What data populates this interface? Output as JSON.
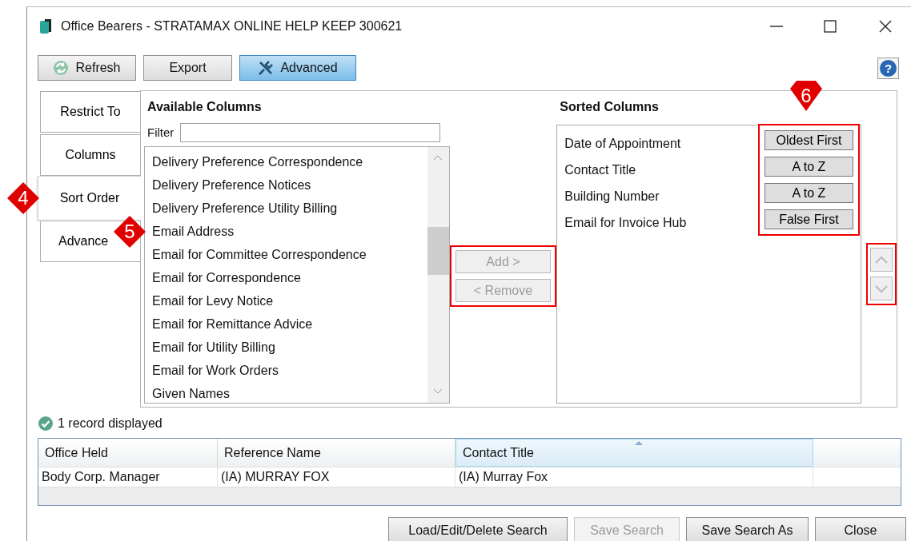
{
  "window": {
    "title": "Office Bearers - STRATAMAX ONLINE HELP KEEP 300621"
  },
  "toolbar": [
    {
      "label": "Refresh",
      "kind": "refresh",
      "selected": false
    },
    {
      "label": "Export",
      "kind": "plain",
      "selected": false
    },
    {
      "label": "Advanced",
      "kind": "tool",
      "selected": true
    }
  ],
  "tabs": [
    {
      "label": "Restrict To",
      "selected": false
    },
    {
      "label": "Columns",
      "selected": false
    },
    {
      "label": "Sort Order",
      "selected": true
    },
    {
      "label": "Advance",
      "selected": false
    }
  ],
  "available_columns": {
    "title": "Available Columns",
    "filter_label": "Filter",
    "items": [
      "Delivery Preference Correspondence",
      "Delivery Preference Notices",
      "Delivery Preference Utility Billing",
      "Email Address",
      "Email for Committee Correspondence",
      "Email for Correspondence",
      "Email for Levy Notice",
      "Email for Remittance Advice",
      "Email for Utility Billing",
      "Email for Work Orders",
      "Given Names"
    ]
  },
  "transfer_buttons": [
    {
      "label": "Add >",
      "disabled": true
    },
    {
      "label": "< Remove",
      "disabled": true
    }
  ],
  "sorted_columns": {
    "title": "Sorted Columns",
    "items": [
      {
        "name": "Date of Appointment",
        "order": "Oldest First"
      },
      {
        "name": "Contact Title",
        "order": "A to Z"
      },
      {
        "name": "Building Number",
        "order": "A to Z"
      },
      {
        "name": "Email for Invoice Hub",
        "order": "False First"
      }
    ]
  },
  "move_buttons": [
    {
      "kind": "up",
      "disabled": true
    },
    {
      "kind": "down",
      "disabled": true
    }
  ],
  "help_button": "?",
  "status": "1 record displayed",
  "table": {
    "columns": [
      {
        "label": "Office Held",
        "sorted": false
      },
      {
        "label": "Reference Name",
        "sorted": false
      },
      {
        "label": "Contact Title",
        "sorted": true
      }
    ],
    "rows": [
      [
        "Body Corp. Manager",
        "(IA) MURRAY FOX",
        "(IA) Murray Fox"
      ]
    ]
  },
  "footer_buttons": [
    {
      "label": "Load/Edit/Delete Search",
      "disabled": false
    },
    {
      "label": "Save Search",
      "disabled": true
    },
    {
      "label": "Save Search As",
      "disabled": false
    },
    {
      "label": "Close",
      "disabled": false
    }
  ],
  "callouts": [
    "4",
    "5",
    "6"
  ]
}
